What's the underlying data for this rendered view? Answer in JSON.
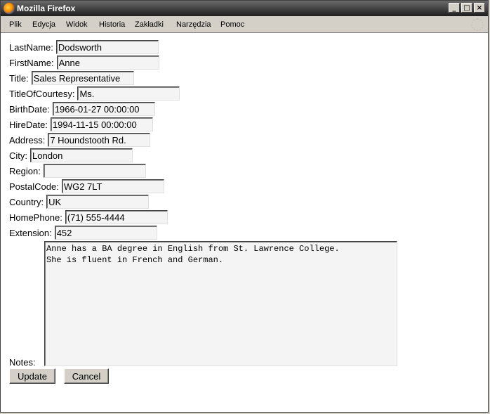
{
  "window": {
    "title": "Mozilla Firefox"
  },
  "menu": [
    "Plik",
    "Edycja",
    "Widok",
    "Historia",
    "Zakładki",
    "Narzędzia",
    "Pomoc"
  ],
  "fields": {
    "last_name": {
      "label": "LastName:",
      "value": "Dodsworth"
    },
    "first_name": {
      "label": "FirstName:",
      "value": "Anne"
    },
    "title": {
      "label": "Title:",
      "value": "Sales Representative"
    },
    "title_of_courtesy": {
      "label": "TitleOfCourtesy:",
      "value": "Ms."
    },
    "birth_date": {
      "label": "BirthDate:",
      "value": "1966-01-27 00:00:00"
    },
    "hire_date": {
      "label": "HireDate:",
      "value": "1994-11-15 00:00:00"
    },
    "address": {
      "label": "Address:",
      "value": "7 Houndstooth Rd."
    },
    "city": {
      "label": "City:",
      "value": "London"
    },
    "region": {
      "label": "Region:",
      "value": ""
    },
    "postal_code": {
      "label": "PostalCode:",
      "value": "WG2 7LT"
    },
    "country": {
      "label": "Country:",
      "value": "UK"
    },
    "home_phone": {
      "label": "HomePhone:",
      "value": "(71) 555-4444"
    },
    "extension": {
      "label": "Extension:",
      "value": "452"
    }
  },
  "notes": {
    "label": "Notes:",
    "value": "Anne has a BA degree in English from St. Lawrence College.\nShe is fluent in French and German."
  },
  "buttons": {
    "update": "Update",
    "cancel": "Cancel"
  }
}
